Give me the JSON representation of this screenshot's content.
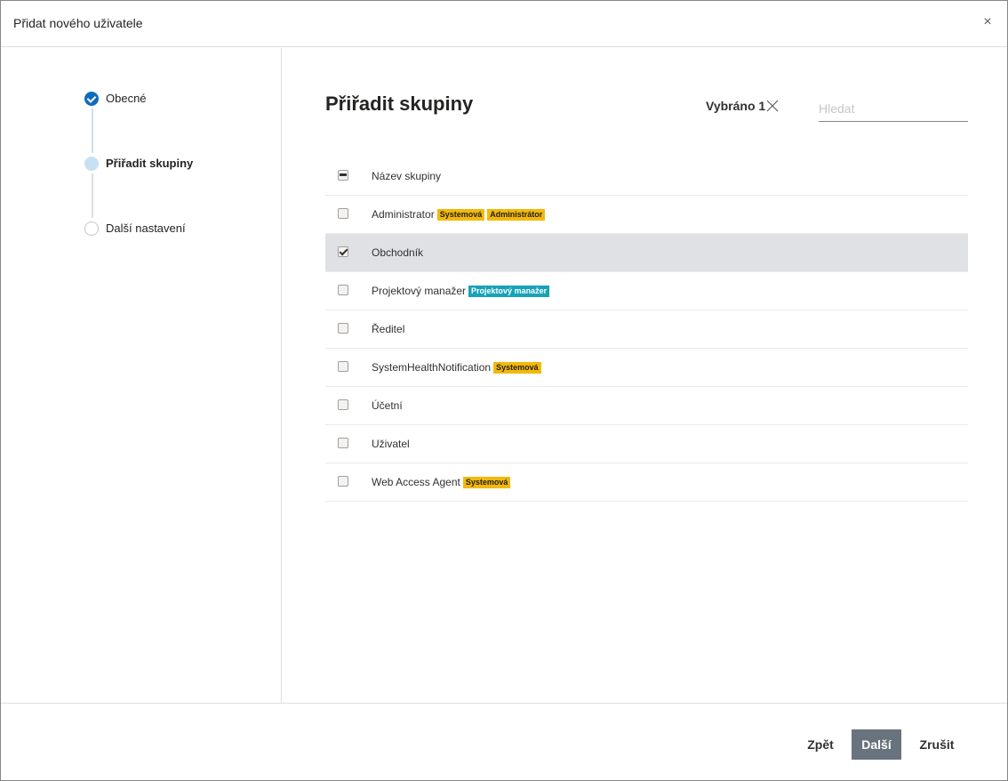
{
  "dialog": {
    "title": "Přidat nového uživatele",
    "close_label": "×"
  },
  "steps": [
    {
      "label": "Obecné",
      "state": "done"
    },
    {
      "label": "Přiřadit skupiny",
      "state": "current"
    },
    {
      "label": "Další nastavení",
      "state": "pending"
    }
  ],
  "main": {
    "title": "Přiřadit skupiny",
    "selected_label": "Vybráno 1",
    "search": {
      "placeholder": "Hledat",
      "value": ""
    }
  },
  "table": {
    "header": "Název skupiny",
    "rows": [
      {
        "name": "Administrator",
        "checked": false,
        "badges": [
          {
            "text": "Systemová",
            "color": "#f2b90b"
          },
          {
            "text": "Administrátor",
            "color": "#f2b90b"
          }
        ]
      },
      {
        "name": "Obchodník",
        "checked": true,
        "badges": []
      },
      {
        "name": "Projektový manažer",
        "checked": false,
        "badges": [
          {
            "text": "Projektový manažer",
            "color": "#17a2b8"
          }
        ]
      },
      {
        "name": "Ředitel",
        "checked": false,
        "badges": []
      },
      {
        "name": "SystemHealthNotification",
        "checked": false,
        "badges": [
          {
            "text": "Systemová",
            "color": "#f2b90b"
          }
        ]
      },
      {
        "name": "Účetní",
        "checked": false,
        "badges": []
      },
      {
        "name": "Uživatel",
        "checked": false,
        "badges": []
      },
      {
        "name": "Web Access Agent",
        "checked": false,
        "badges": [
          {
            "text": "Systemová",
            "color": "#f2b90b"
          }
        ]
      }
    ]
  },
  "footer": {
    "back_label": "Zpět",
    "next_label": "Další",
    "cancel_label": "Zrušit"
  },
  "colors": {
    "accent": "#0f6cbd",
    "selected_row": "#dfe1e5",
    "primary_button": "#69737d"
  }
}
